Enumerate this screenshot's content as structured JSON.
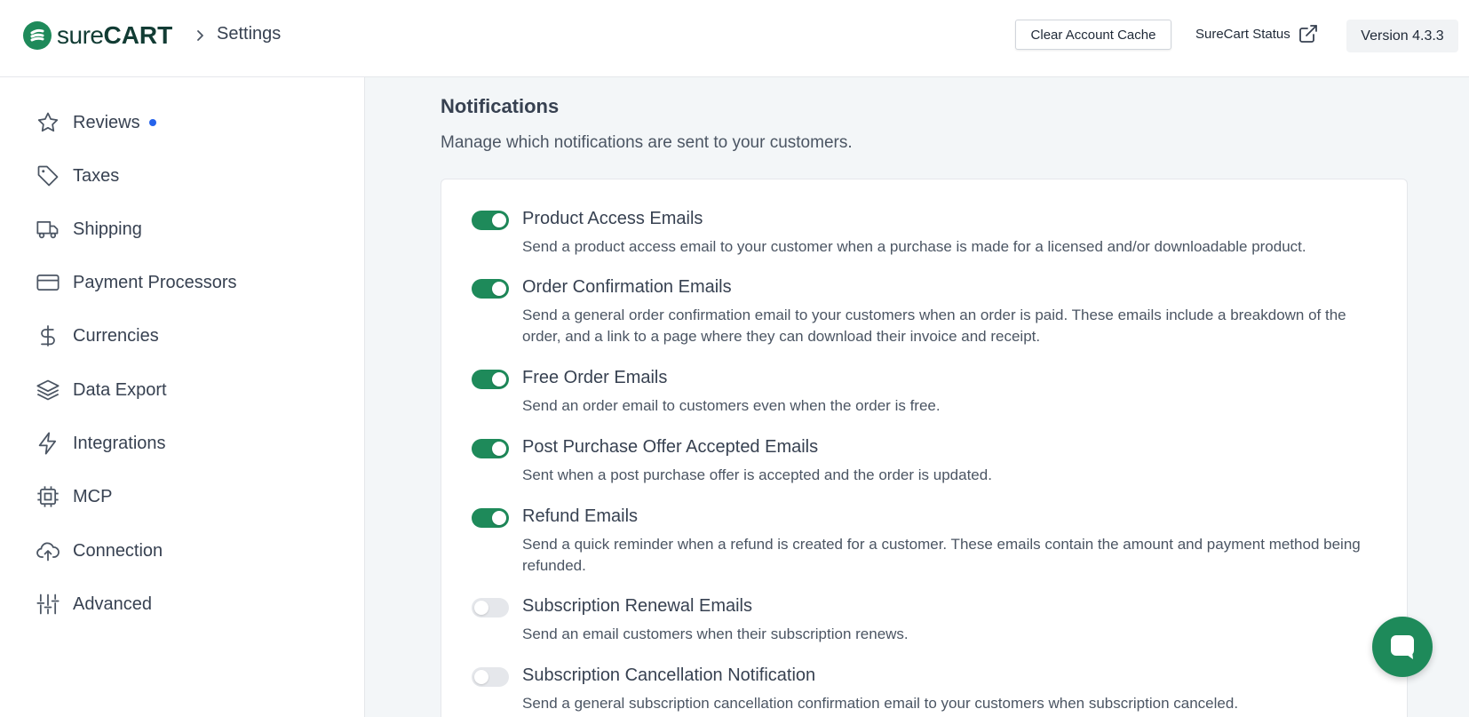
{
  "header": {
    "logo_sure": "sure",
    "logo_cart": "CART",
    "breadcrumb": "Settings",
    "clear_cache_label": "Clear Account Cache",
    "status_label": "SureCart Status",
    "version_label": "Version 4.3.3"
  },
  "sidebar": {
    "items": [
      {
        "label": "Reviews",
        "icon": "star-icon"
      },
      {
        "label": "Taxes",
        "icon": "tag-icon"
      },
      {
        "label": "Shipping",
        "icon": "truck-icon"
      },
      {
        "label": "Payment Processors",
        "icon": "credit-card-icon"
      },
      {
        "label": "Currencies",
        "icon": "dollar-icon"
      },
      {
        "label": "Data Export",
        "icon": "layers-icon"
      },
      {
        "label": "Integrations",
        "icon": "zap-icon"
      },
      {
        "label": "MCP",
        "icon": "cpu-icon"
      },
      {
        "label": "Connection",
        "icon": "upload-cloud-icon"
      },
      {
        "label": "Advanced",
        "icon": "sliders-icon"
      }
    ]
  },
  "main": {
    "title": "Notifications",
    "description": "Manage which notifications are sent to your customers.",
    "notifications": [
      {
        "title": "Product Access Emails",
        "description": "Send a product access email to your customer when a purchase is made for a licensed and/or downloadable product.",
        "enabled": true
      },
      {
        "title": "Order Confirmation Emails",
        "description": "Send a general order confirmation email to your customers when an order is paid. These emails include a breakdown of the order, and a link to a page where they can download their invoice and receipt.",
        "enabled": true
      },
      {
        "title": "Free Order Emails",
        "description": "Send an order email to customers even when the order is free.",
        "enabled": true
      },
      {
        "title": "Post Purchase Offer Accepted Emails",
        "description": "Sent when a post purchase offer is accepted and the order is updated.",
        "enabled": true
      },
      {
        "title": "Refund Emails",
        "description": "Send a quick reminder when a refund is created for a customer. These emails contain the amount and payment method being refunded.",
        "enabled": true
      },
      {
        "title": "Subscription Renewal Emails",
        "description": "Send an email customers when their subscription renews.",
        "enabled": false
      },
      {
        "title": "Subscription Cancellation Notification",
        "description": "Send a general subscription cancellation confirmation email to your customers when subscription canceled.",
        "enabled": false
      }
    ]
  },
  "colors": {
    "brand": "#1e8a5a",
    "toggle_off": "#e5e7eb",
    "badge_dot": "#2563eb"
  },
  "chat": {
    "icon": "chat-bubble-icon"
  }
}
